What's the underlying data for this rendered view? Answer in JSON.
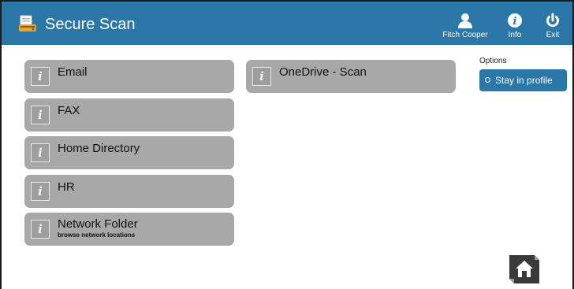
{
  "header": {
    "title": "Secure Scan",
    "user_label": "Fitch Cooper",
    "info_label": "Info",
    "exit_label": "Exit"
  },
  "buttons_col1": [
    {
      "label": "Email",
      "sub": ""
    },
    {
      "label": "FAX",
      "sub": ""
    },
    {
      "label": "Home Directory",
      "sub": ""
    },
    {
      "label": "HR",
      "sub": ""
    },
    {
      "label": "Network Folder",
      "sub": "browse network locations"
    }
  ],
  "buttons_col2": [
    {
      "label": "OneDrive - Scan",
      "sub": ""
    }
  ],
  "options": {
    "heading": "Options",
    "stay_label": "Stay in profile"
  },
  "icons": {
    "info_button_icon": "i",
    "app": "scanner-icon",
    "user": "user-icon",
    "info": "info-icon",
    "exit": "power-icon",
    "home": "home-icon"
  },
  "colors": {
    "header": "#2a77a8",
    "button": "#a8a8a8",
    "options_button": "#2a77a8"
  }
}
